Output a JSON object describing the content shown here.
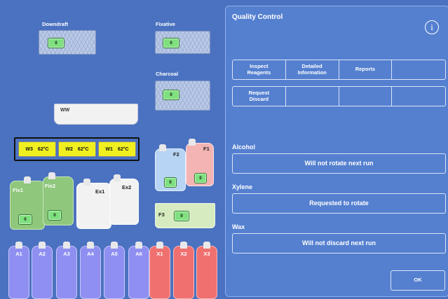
{
  "left": {
    "downdraft": {
      "label": "Downdraft",
      "value": "0"
    },
    "fixative": {
      "label": "Fixative",
      "value": "0"
    },
    "charcoal": {
      "label": "Charcoal",
      "value": "0"
    },
    "ww_label": "WW",
    "wax_baths": [
      {
        "label": "W3",
        "temp": "62°C"
      },
      {
        "label": "W2",
        "temp": "62°C"
      },
      {
        "label": "W1",
        "temp": "62°C"
      }
    ],
    "f2": {
      "label": "F2",
      "value": "0"
    },
    "f1": {
      "label": "F1",
      "value": "0"
    },
    "fix1": {
      "label": "Fix1",
      "value": "0"
    },
    "fix2": {
      "label": "Fix2",
      "value": "0"
    },
    "ex1": {
      "label": "Ex1"
    },
    "ex2": {
      "label": "Ex2"
    },
    "f3": {
      "label": "F3",
      "value": "0"
    },
    "bottles": [
      {
        "label": "A1",
        "color": "#8f8ff2"
      },
      {
        "label": "A2",
        "color": "#8f8ff2"
      },
      {
        "label": "A3",
        "color": "#8f8ff2"
      },
      {
        "label": "A4",
        "color": "#8f8ff2"
      },
      {
        "label": "A5",
        "color": "#8f8ff2"
      },
      {
        "label": "A6",
        "color": "#8f8ff2"
      },
      {
        "label": "X1",
        "color": "#f07070"
      },
      {
        "label": "X2",
        "color": "#f07070"
      },
      {
        "label": "X3",
        "color": "#f07070"
      }
    ]
  },
  "panel": {
    "title": "Quality Control",
    "info_icon": "i",
    "tabs_row1": [
      "Inspect\nReagents",
      "Detailed\nInformation",
      "Reports",
      ""
    ],
    "tabs_row2": [
      "Request\nDiscard",
      "",
      "",
      ""
    ],
    "sections": [
      {
        "heading": "Alcohol",
        "status": "Will not rotate next run"
      },
      {
        "heading": "Xylene",
        "status": "Requested to rotate"
      },
      {
        "heading": "Wax",
        "status": "Will not discard next run"
      }
    ],
    "ok_label": "OK"
  }
}
